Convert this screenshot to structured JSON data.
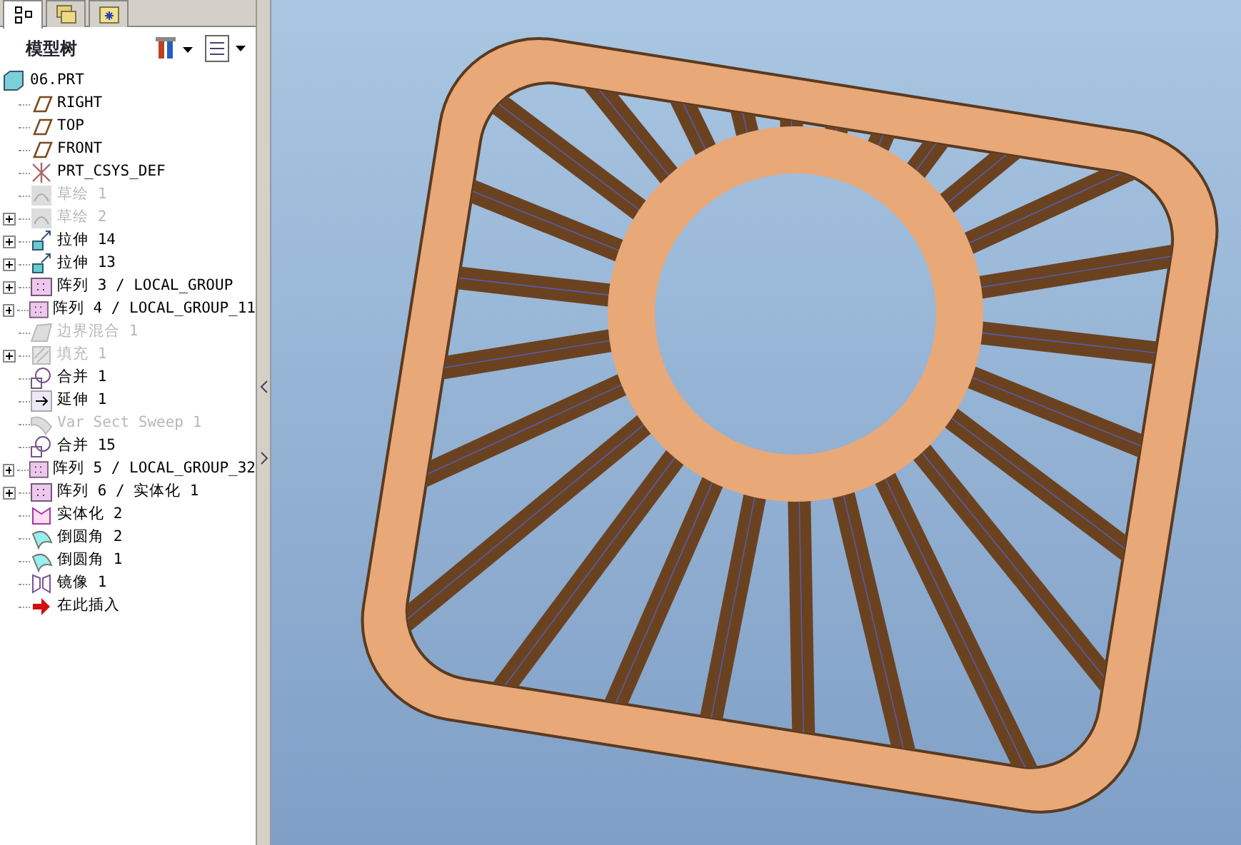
{
  "panel_tabs": [
    {
      "kind": "tree",
      "selected": true
    },
    {
      "kind": "layers",
      "selected": false
    },
    {
      "kind": "favorites",
      "selected": false
    }
  ],
  "tree_title": "模型树",
  "tree": {
    "label": "06.PRT",
    "kind": "part",
    "children": [
      {
        "label": "RIGHT",
        "kind": "plane",
        "suppressed": false,
        "expandable": false
      },
      {
        "label": "TOP",
        "kind": "plane",
        "suppressed": false,
        "expandable": false
      },
      {
        "label": "FRONT",
        "kind": "plane",
        "suppressed": false,
        "expandable": false
      },
      {
        "label": "PRT_CSYS_DEF",
        "kind": "csys",
        "suppressed": false,
        "expandable": false
      },
      {
        "label": "草绘 1",
        "kind": "sketch",
        "suppressed": true,
        "expandable": false
      },
      {
        "label": "草绘 2",
        "kind": "sketch",
        "suppressed": true,
        "expandable": true
      },
      {
        "label": "拉伸 14",
        "kind": "extrude",
        "suppressed": false,
        "expandable": true
      },
      {
        "label": "拉伸 13",
        "kind": "extrude",
        "suppressed": false,
        "expandable": true
      },
      {
        "label": "阵列 3 / LOCAL_GROUP",
        "kind": "pattern",
        "suppressed": false,
        "expandable": true
      },
      {
        "label": "阵列 4 / LOCAL_GROUP_11",
        "kind": "pattern",
        "suppressed": false,
        "expandable": true
      },
      {
        "label": "边界混合 1",
        "kind": "blend",
        "suppressed": true,
        "expandable": false
      },
      {
        "label": "填充 1",
        "kind": "fill",
        "suppressed": true,
        "expandable": true
      },
      {
        "label": "合并 1",
        "kind": "merge",
        "suppressed": false,
        "expandable": false
      },
      {
        "label": "延伸 1",
        "kind": "extend",
        "suppressed": false,
        "expandable": false
      },
      {
        "label": "Var Sect Sweep 1",
        "kind": "sweep",
        "suppressed": true,
        "expandable": false
      },
      {
        "label": "合并 15",
        "kind": "merge",
        "suppressed": false,
        "expandable": false
      },
      {
        "label": "阵列 5 / LOCAL_GROUP_32",
        "kind": "pattern",
        "suppressed": false,
        "expandable": true
      },
      {
        "label": "阵列 6 / 实体化 1",
        "kind": "pattern",
        "suppressed": false,
        "expandable": true
      },
      {
        "label": "实体化 2",
        "kind": "solidify",
        "suppressed": false,
        "expandable": false
      },
      {
        "label": "倒圆角 2",
        "kind": "round",
        "suppressed": false,
        "expandable": false
      },
      {
        "label": "倒圆角 1",
        "kind": "round",
        "suppressed": false,
        "expandable": false
      },
      {
        "label": "镜像 1",
        "kind": "mirror",
        "suppressed": false,
        "expandable": false
      },
      {
        "label": "在此插入",
        "kind": "insert",
        "suppressed": false,
        "expandable": false
      }
    ]
  }
}
